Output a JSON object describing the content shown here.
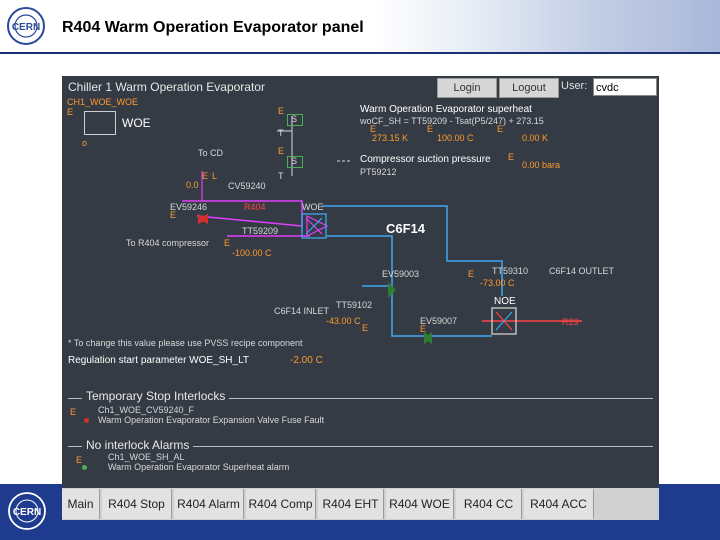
{
  "slide": {
    "title": "R404 Warm Operation Evaporator panel"
  },
  "panel": {
    "title": "Chiller 1 Warm Operation Evaporator",
    "login_label": "Login",
    "logout_label": "Logout",
    "user_label": "User:",
    "user_value": "cvdc"
  },
  "diagram": {
    "woe_label_small": "CH1_WOE_WOE",
    "woe_box": "WOE",
    "marker_e": "E",
    "marker_t": "T",
    "marker_l": "L",
    "marker_b": "B",
    "marker_o": "o",
    "box_s": "S",
    "superheat_title": "Warm Operation Evaporator superheat",
    "superheat_eq": "woCF_SH   =   TT59209   -   Tsat(P5/247) + 273.15",
    "superheat_v1": "273.15 K",
    "superheat_v2": "100.00 C",
    "superheat_v3": "0.00 K",
    "to_cd": "To CD",
    "cv_label": "CV59240",
    "val_00": "0.0",
    "compressor_suction": "Compressor suction pressure",
    "compressor_pt": "PT59212",
    "compressor_value": "0.00 bara",
    "ev_label": "EV59246",
    "r404_label": "R404",
    "tt_label": "TT59209",
    "to_r404": "To R404 compressor",
    "tt_value": "-100.00 C",
    "woe_hx": "WOE",
    "c6f14": "C6F14",
    "ev_59003": "EV59003",
    "tt_59310": "TT59310",
    "c6f14_outlet": "C6F14 OUTLET",
    "tt_59310_value": "-73.00 C",
    "tt_59102": "TT59102",
    "c6f14_inlet": "C6F14 INLET",
    "tt_59102_value": "-43.00 C",
    "ev_59007": "EV59007",
    "noe_label": "NOE",
    "r23_label": "R23",
    "note": "* To change this value please use PVSS recipe component",
    "reg_label": "Regulation start parameter WOE_SH_LT",
    "reg_value": "-2.00 C"
  },
  "temp_stop": {
    "title": "Temporary Stop Interlocks",
    "id": "Ch1_WOE_CV59240_F",
    "desc": "Warm Operation Evaporator Expansion Valve Fuse Fault"
  },
  "alarms": {
    "title": "No interlock Alarms",
    "id": "Ch1_WOE_SH_AL",
    "desc": "Warm Operation Evaporator Superheat alarm"
  },
  "nav": [
    "Main",
    "R404 Stop",
    "R404 Alarm",
    "R404 Comp",
    "R404 EHT",
    "R404 WOE",
    "R404 CC",
    "R404 ACC"
  ],
  "colors": {
    "panel": "#353b44",
    "footer": "#1f3b8e",
    "pipe_blue": "#3fa8f0",
    "pipe_magenta": "#e040fb",
    "orange": "#ff9a2e",
    "red": "#ff4444"
  }
}
